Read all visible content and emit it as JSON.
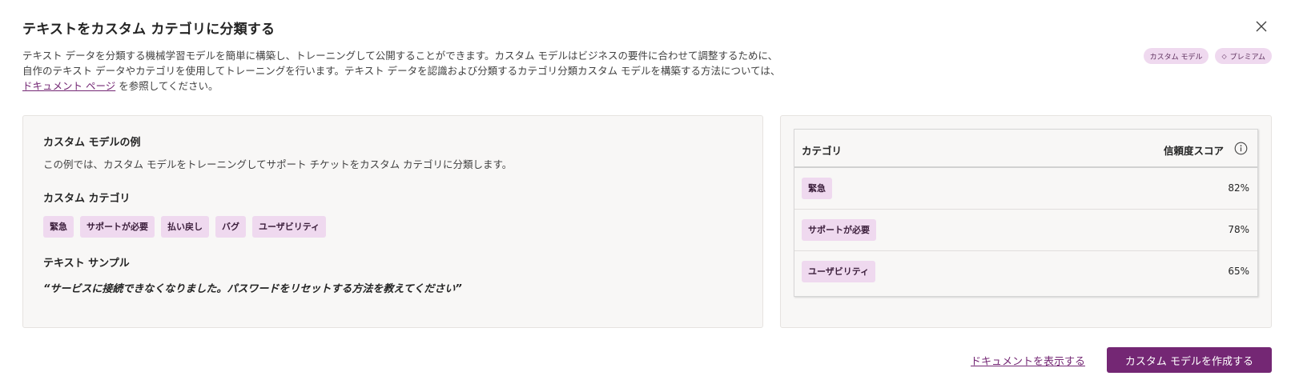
{
  "dialog": {
    "title": "テキストをカスタム カテゴリに分類する",
    "description_line1": "テキスト データを分類する機械学習モデルを簡単に構築し、トレーニングして公開することができます。カスタム モデルはビジネスの要件に合わせて調整するために、",
    "description_line2": "自作のテキスト データやカテゴリを使用してトレーニングを行います。テキスト データを認識および分類するカテゴリ分類カスタム モデルを構築する方法については、",
    "description_link": "ドキュメント ページ",
    "description_suffix": " を参照してください。",
    "tags": {
      "custom_model": "カスタム モデル",
      "premium": "プレミアム"
    }
  },
  "example": {
    "heading": "カスタム モデルの例",
    "text": "この例では、カスタム モデルをトレーニングしてサポート チケットをカスタム カテゴリに分類します。",
    "categories_heading": "カスタム カテゴリ",
    "categories": [
      "緊急",
      "サポートが必要",
      "払い戻し",
      "バグ",
      "ユーザビリティ"
    ],
    "sample_heading": "テキスト サンプル",
    "sample_text": "“サービスに接続できなくなりました。パスワードをリセットする方法を教えてください”"
  },
  "results_table": {
    "col_category": "カテゴリ",
    "col_score": "信頼度スコア",
    "rows": [
      {
        "category": "緊急",
        "score": "82%"
      },
      {
        "category": "サポートが必要",
        "score": "78%"
      },
      {
        "category": "ユーザビリティ",
        "score": "65%"
      }
    ]
  },
  "footer": {
    "docs_link": "ドキュメントを表示する",
    "create_button": "カスタム モデルを作成する"
  },
  "colors": {
    "accent": "#742774",
    "chip_bg": "#efd9ef",
    "panel_bg": "#f8f7f6"
  },
  "icons": {
    "close": "close-icon",
    "info": "info-icon",
    "premium": "diamond-icon"
  }
}
